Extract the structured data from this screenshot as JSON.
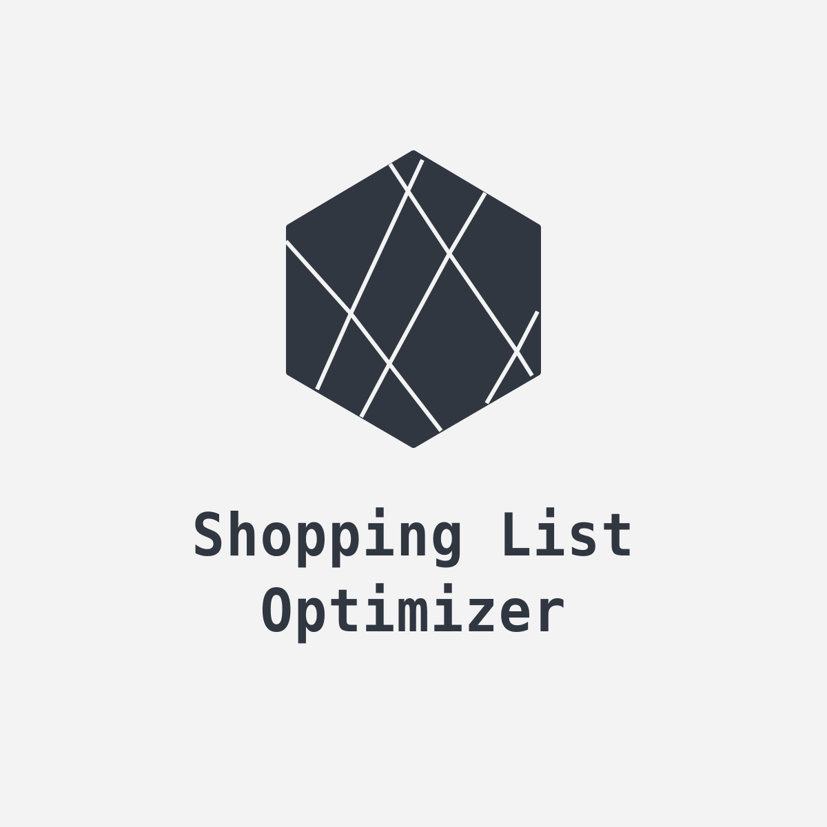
{
  "brand": {
    "name": "Shopping List Optimizer",
    "colors": {
      "background": "#f3f3f3",
      "mark": "#303741",
      "mark_lines": "#f3f3f3",
      "text": "#303741"
    },
    "mark_icon": "faceted-hexagon-gem-icon"
  }
}
